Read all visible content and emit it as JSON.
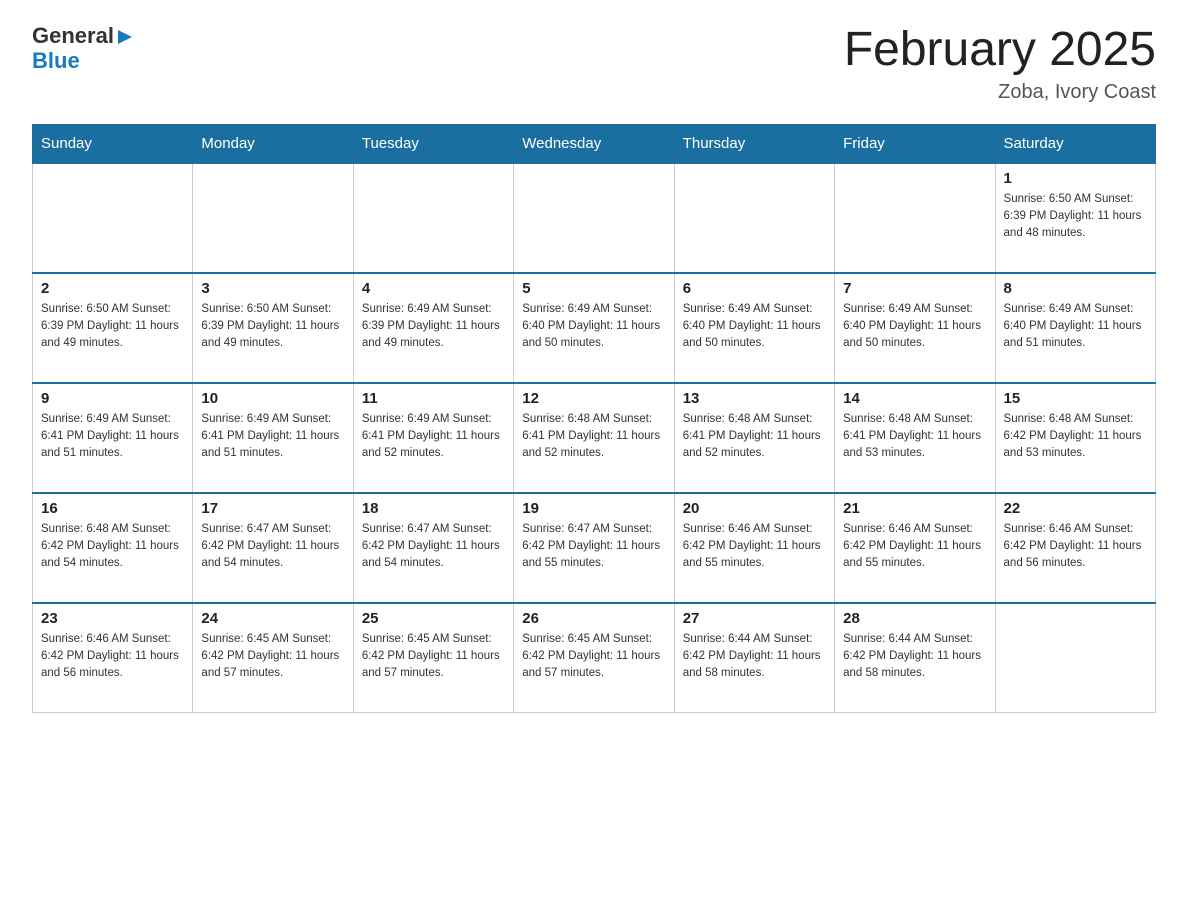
{
  "logo": {
    "general": "General",
    "blue": "Blue",
    "arrow": "▶"
  },
  "header": {
    "title": "February 2025",
    "subtitle": "Zoba, Ivory Coast"
  },
  "weekdays": [
    "Sunday",
    "Monday",
    "Tuesday",
    "Wednesday",
    "Thursday",
    "Friday",
    "Saturday"
  ],
  "weeks": [
    [
      {
        "day": "",
        "info": ""
      },
      {
        "day": "",
        "info": ""
      },
      {
        "day": "",
        "info": ""
      },
      {
        "day": "",
        "info": ""
      },
      {
        "day": "",
        "info": ""
      },
      {
        "day": "",
        "info": ""
      },
      {
        "day": "1",
        "info": "Sunrise: 6:50 AM\nSunset: 6:39 PM\nDaylight: 11 hours\nand 48 minutes."
      }
    ],
    [
      {
        "day": "2",
        "info": "Sunrise: 6:50 AM\nSunset: 6:39 PM\nDaylight: 11 hours\nand 49 minutes."
      },
      {
        "day": "3",
        "info": "Sunrise: 6:50 AM\nSunset: 6:39 PM\nDaylight: 11 hours\nand 49 minutes."
      },
      {
        "day": "4",
        "info": "Sunrise: 6:49 AM\nSunset: 6:39 PM\nDaylight: 11 hours\nand 49 minutes."
      },
      {
        "day": "5",
        "info": "Sunrise: 6:49 AM\nSunset: 6:40 PM\nDaylight: 11 hours\nand 50 minutes."
      },
      {
        "day": "6",
        "info": "Sunrise: 6:49 AM\nSunset: 6:40 PM\nDaylight: 11 hours\nand 50 minutes."
      },
      {
        "day": "7",
        "info": "Sunrise: 6:49 AM\nSunset: 6:40 PM\nDaylight: 11 hours\nand 50 minutes."
      },
      {
        "day": "8",
        "info": "Sunrise: 6:49 AM\nSunset: 6:40 PM\nDaylight: 11 hours\nand 51 minutes."
      }
    ],
    [
      {
        "day": "9",
        "info": "Sunrise: 6:49 AM\nSunset: 6:41 PM\nDaylight: 11 hours\nand 51 minutes."
      },
      {
        "day": "10",
        "info": "Sunrise: 6:49 AM\nSunset: 6:41 PM\nDaylight: 11 hours\nand 51 minutes."
      },
      {
        "day": "11",
        "info": "Sunrise: 6:49 AM\nSunset: 6:41 PM\nDaylight: 11 hours\nand 52 minutes."
      },
      {
        "day": "12",
        "info": "Sunrise: 6:48 AM\nSunset: 6:41 PM\nDaylight: 11 hours\nand 52 minutes."
      },
      {
        "day": "13",
        "info": "Sunrise: 6:48 AM\nSunset: 6:41 PM\nDaylight: 11 hours\nand 52 minutes."
      },
      {
        "day": "14",
        "info": "Sunrise: 6:48 AM\nSunset: 6:41 PM\nDaylight: 11 hours\nand 53 minutes."
      },
      {
        "day": "15",
        "info": "Sunrise: 6:48 AM\nSunset: 6:42 PM\nDaylight: 11 hours\nand 53 minutes."
      }
    ],
    [
      {
        "day": "16",
        "info": "Sunrise: 6:48 AM\nSunset: 6:42 PM\nDaylight: 11 hours\nand 54 minutes."
      },
      {
        "day": "17",
        "info": "Sunrise: 6:47 AM\nSunset: 6:42 PM\nDaylight: 11 hours\nand 54 minutes."
      },
      {
        "day": "18",
        "info": "Sunrise: 6:47 AM\nSunset: 6:42 PM\nDaylight: 11 hours\nand 54 minutes."
      },
      {
        "day": "19",
        "info": "Sunrise: 6:47 AM\nSunset: 6:42 PM\nDaylight: 11 hours\nand 55 minutes."
      },
      {
        "day": "20",
        "info": "Sunrise: 6:46 AM\nSunset: 6:42 PM\nDaylight: 11 hours\nand 55 minutes."
      },
      {
        "day": "21",
        "info": "Sunrise: 6:46 AM\nSunset: 6:42 PM\nDaylight: 11 hours\nand 55 minutes."
      },
      {
        "day": "22",
        "info": "Sunrise: 6:46 AM\nSunset: 6:42 PM\nDaylight: 11 hours\nand 56 minutes."
      }
    ],
    [
      {
        "day": "23",
        "info": "Sunrise: 6:46 AM\nSunset: 6:42 PM\nDaylight: 11 hours\nand 56 minutes."
      },
      {
        "day": "24",
        "info": "Sunrise: 6:45 AM\nSunset: 6:42 PM\nDaylight: 11 hours\nand 57 minutes."
      },
      {
        "day": "25",
        "info": "Sunrise: 6:45 AM\nSunset: 6:42 PM\nDaylight: 11 hours\nand 57 minutes."
      },
      {
        "day": "26",
        "info": "Sunrise: 6:45 AM\nSunset: 6:42 PM\nDaylight: 11 hours\nand 57 minutes."
      },
      {
        "day": "27",
        "info": "Sunrise: 6:44 AM\nSunset: 6:42 PM\nDaylight: 11 hours\nand 58 minutes."
      },
      {
        "day": "28",
        "info": "Sunrise: 6:44 AM\nSunset: 6:42 PM\nDaylight: 11 hours\nand 58 minutes."
      },
      {
        "day": "",
        "info": ""
      }
    ]
  ]
}
